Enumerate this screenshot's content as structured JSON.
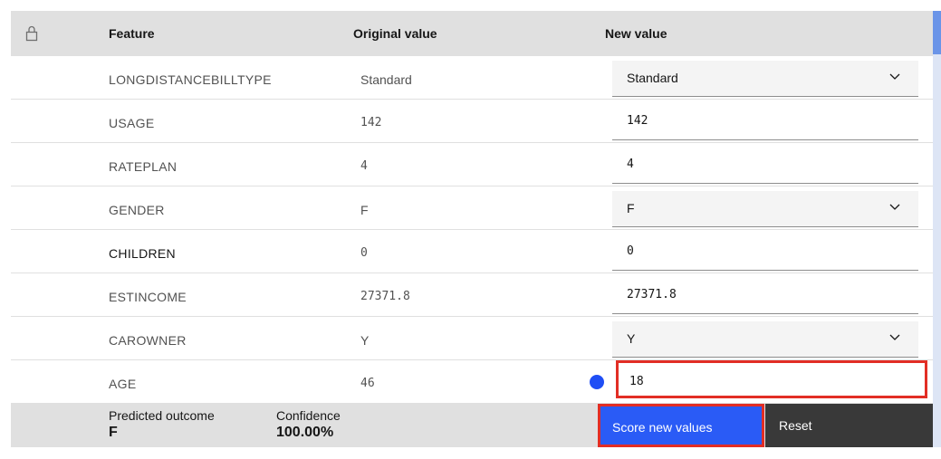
{
  "header": {
    "lock_icon": "lock-icon",
    "feature": "Feature",
    "original_value": "Original value",
    "new_value": "New value"
  },
  "rows": [
    {
      "feature": "LONGDISTANCEBILLTYPE",
      "original": "Standard",
      "new": "Standard",
      "control": "select"
    },
    {
      "feature": "USAGE",
      "original": "142",
      "new": "142",
      "control": "input"
    },
    {
      "feature": "RATEPLAN",
      "original": "4",
      "new": "4",
      "control": "input"
    },
    {
      "feature": "GENDER",
      "original": "F",
      "new": "F",
      "control": "select"
    },
    {
      "feature": "CHILDREN",
      "original": "0",
      "new": "0",
      "control": "input"
    },
    {
      "feature": "ESTINCOME",
      "original": "27371.8",
      "new": "27371.8",
      "control": "input"
    },
    {
      "feature": "CAROWNER",
      "original": "Y",
      "new": "Y",
      "control": "select"
    },
    {
      "feature": "AGE",
      "original": "46",
      "new": "18",
      "control": "input",
      "changed": true
    }
  ],
  "footer": {
    "predicted_label": "Predicted outcome",
    "predicted_value": "F",
    "confidence_label": "Confidence",
    "confidence_value": "100.00%",
    "score_button": "Score new values",
    "reset_button": "Reset"
  },
  "colors": {
    "accent": "#2a5bf6",
    "highlight": "#e22e25",
    "changed_dot": "#1f4ef5",
    "dark_button": "#393939"
  }
}
